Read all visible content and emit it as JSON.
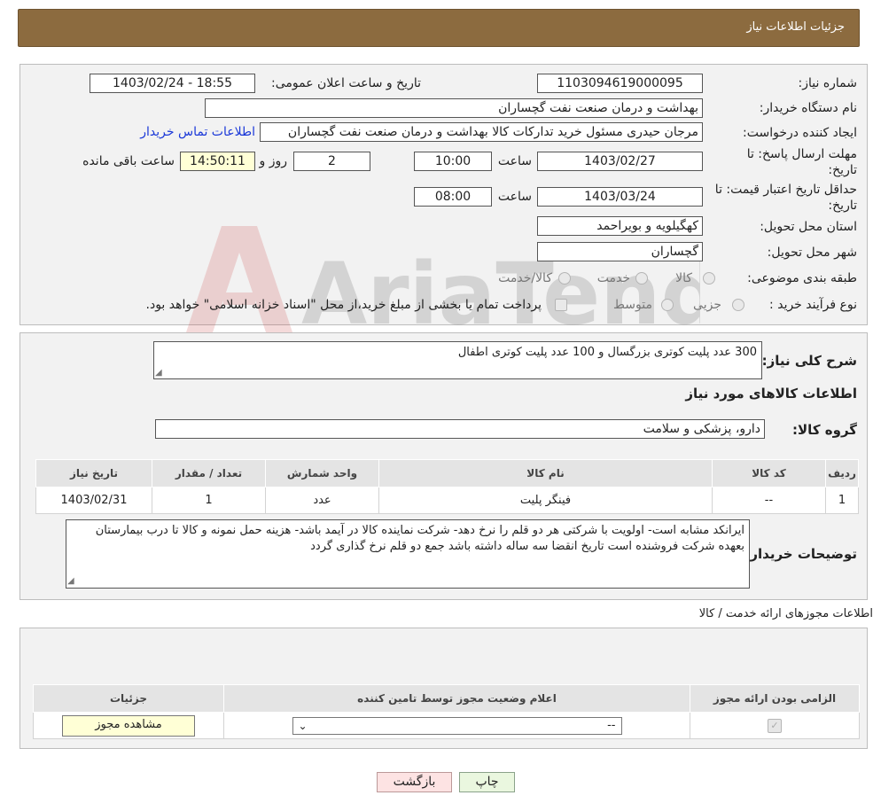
{
  "header": {
    "title": "جزئیات اطلاعات نیاز"
  },
  "fields": {
    "need_number_label": "شماره نیاز:",
    "need_number": "1103094619000095",
    "announce_label": "تاریخ و ساعت اعلان عمومی:",
    "announce_value": "1403/02/24 - 18:55",
    "buyer_org_label": "نام دستگاه خریدار:",
    "buyer_org": "بهداشت و درمان صنعت نفت گچساران",
    "requester_label": "ایجاد کننده درخواست:",
    "requester": "مرجان  حیدری مسئول خرید تدارکات کالا  بهداشت و درمان صنعت نفت گچساران",
    "contact_link": "اطلاعات تماس خریدار",
    "deadline_label_1": "مهلت ارسال پاسخ: تا",
    "deadline_label_2": "تاریخ:",
    "deadline_date": "1403/02/27",
    "time_label": "ساعت",
    "deadline_time": "10:00",
    "days_value": "2",
    "days_label": "روز و",
    "remaining_value": "14:50:11",
    "remaining_label": "ساعت باقی مانده",
    "validity_label_1": "حداقل تاریخ اعتبار قیمت: تا",
    "validity_label_2": "تاریخ:",
    "validity_date": "1403/03/24",
    "validity_time": "08:00",
    "province_label": "استان محل تحویل:",
    "province": "کهگیلویه و بویراحمد",
    "city_label": "شهر محل تحویل:",
    "city": "گچساران",
    "category_label": "طبقه بندی موضوعی:",
    "category_options": [
      "کالا",
      "خدمت",
      "کالا/خدمت"
    ],
    "process_label": "نوع فرآیند خرید :",
    "process_options": [
      "جزیی",
      "متوسط"
    ],
    "payment_note": "پرداخت تمام یا بخشی از مبلغ خرید،از محل \"اسناد خزانه اسلامی\" خواهد بود."
  },
  "details": {
    "summary_label": "شرح کلی نیاز:",
    "summary": "300 عدد پلیت کوتری بزرگسال و 100 عدد پلیت کوتری اطفال",
    "goods_heading": "اطلاعات کالاهای مورد نیاز",
    "group_label": "گروه کالا:",
    "group_value": "دارو، پزشکی و سلامت",
    "table_headers": [
      "ردیف",
      "کد کالا",
      "نام کالا",
      "واحد شمارش",
      "تعداد / مقدار",
      "تاریخ نیاز"
    ],
    "table_rows": [
      [
        "1",
        "--",
        "فینگر پلیت",
        "عدد",
        "1",
        "1403/02/31"
      ]
    ],
    "buyer_notes_label": "توضیحات خریدار:",
    "buyer_notes": "ایرانکد مشابه است- اولویت با شرکتی هر دو قلم را نرخ دهد- شرکت نماینده کالا در آیمد باشد- هزینه حمل نمونه و کالا تا درب بیمارستان بعهده شرکت فروشنده است تاریخ انقضا سه ساله داشته باشد جمع دو قلم نرخ گذاری گردد"
  },
  "permits": {
    "title": "اطلاعات مجوزهای ارائه خدمت / کالا",
    "headers": [
      "الزامی بودن ارائه مجوز",
      "اعلام وضعیت مجوز توسط تامین کننده",
      "جزئیات"
    ],
    "select_value": "--",
    "view_button": "مشاهده مجوز"
  },
  "buttons": {
    "print": "چاپ",
    "back": "بازگشت"
  },
  "watermark": {
    "text": "AriaTender.neT"
  },
  "colors": {
    "header_bg": "#8c6b3f",
    "link": "#1a38d8",
    "remaining_bg": "#ffffd6"
  }
}
